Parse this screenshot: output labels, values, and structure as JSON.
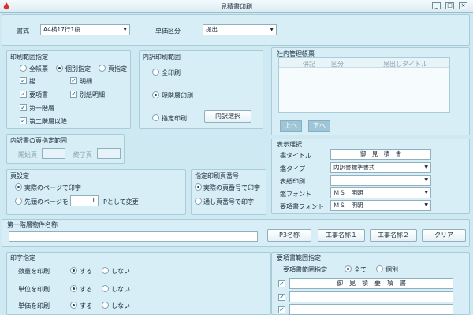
{
  "window": {
    "title": "見積書印刷",
    "app_icon": "flame-icon",
    "controls": [
      "_",
      "□",
      "×"
    ]
  },
  "format": {
    "label": "書式",
    "value": "A4横17行1段"
  },
  "unit_price": {
    "label": "単価区分",
    "value": "提出"
  },
  "print_range": {
    "title": "印刷範囲指定",
    "radios": [
      "全帳票",
      "個別指定",
      "頁指定"
    ],
    "selected": "個別指定",
    "checks": [
      {
        "label": "鑑",
        "checked": true
      },
      {
        "label": "明細",
        "checked": true
      },
      {
        "label": "要項書",
        "checked": true
      },
      {
        "label": "別紙明細",
        "checked": true
      },
      {
        "label": "第一階層",
        "checked": true
      },
      {
        "label": "第二階層以降",
        "checked": true
      }
    ]
  },
  "breakdown": {
    "title": "内訳印刷範囲",
    "options": [
      "全印刷",
      "現階層印刷",
      "指定印刷"
    ],
    "selected": "現階層印刷",
    "select_button": "内訳選択"
  },
  "page_range": {
    "title": "内訳書の頁指定範囲",
    "start_label": "開始頁",
    "end_label": "終了頁"
  },
  "page_setting": {
    "title": "頁設定",
    "options": [
      "実際のページで印字",
      "先頭のページを"
    ],
    "selected": "実際のページで印字",
    "first_page_value": "1",
    "suffix": "Pとして変更"
  },
  "page_number": {
    "title": "指定印刷頁番号",
    "options": [
      "実際の頁番号で印字",
      "通し頁番号で印字"
    ],
    "selected": "実際の頁番号で印字"
  },
  "internal_forms": {
    "title": "社内管理帳票",
    "columns": [
      "併記",
      "区分",
      "見出しタイトル"
    ],
    "up_button": "上へ",
    "down_button": "下へ"
  },
  "display": {
    "title": "表示選択",
    "kagami_title_label": "鑑タイトル",
    "kagami_title_value": "御　見　積　書",
    "kagami_type_label": "鑑タイプ",
    "kagami_type_value": "内訳書標準書式",
    "cover_label": "表紙印刷",
    "cover_value": "",
    "kagami_font_label": "鑑フォント",
    "kagami_font_value": "ＭＳ　明朝",
    "req_font_label": "要項書フォント",
    "req_font_value": "ＭＳ　明朝"
  },
  "first_layer": {
    "title": "第一階層物件名称",
    "value": "",
    "buttons": [
      "P3名称",
      "工事名称１",
      "工事名称２",
      "クリア"
    ]
  },
  "print_spec": {
    "title": "印字指定",
    "rows": [
      {
        "label": "数量を印刷",
        "selected": "する"
      },
      {
        "label": "単位を印刷",
        "selected": "する"
      },
      {
        "label": "単価を印刷",
        "selected": "する"
      }
    ],
    "yes": "する",
    "no": "しない"
  },
  "req_range": {
    "title": "要項書範囲指定",
    "label": "要項書範囲指定",
    "options": [
      "全て",
      "個別"
    ],
    "selected": "全て",
    "header": "御　見　積　要　項　書",
    "rows": [
      {
        "checked": true
      },
      {
        "checked": true
      },
      {
        "checked": true
      }
    ]
  },
  "colors": {
    "background": "#cfe9f3",
    "panel": "#d7eef6",
    "accent": "#9ec6d6",
    "title_text": "#1a2a3a"
  }
}
